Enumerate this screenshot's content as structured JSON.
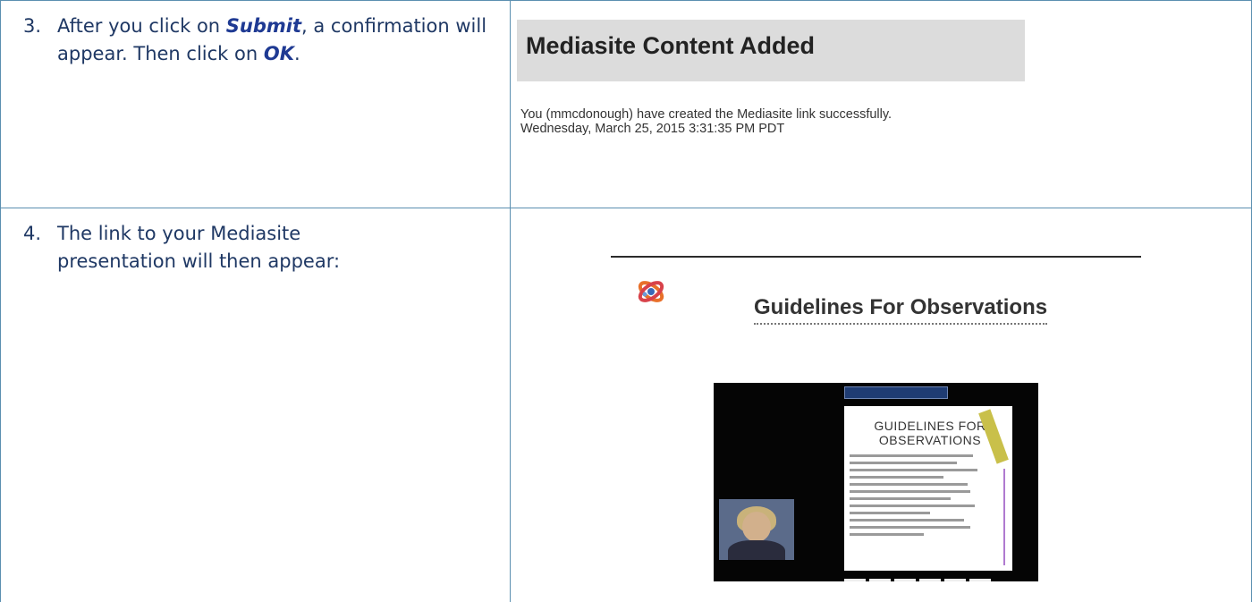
{
  "steps": [
    {
      "number": "3.",
      "text_before": "After you click on ",
      "emphasis1": "Submit",
      "text_mid": ", a confirmation will appear. Then click on ",
      "emphasis2": "OK",
      "text_after": "."
    },
    {
      "number": "4.",
      "text": "The link to your Mediasite presentation will then appear:"
    }
  ],
  "confirmation": {
    "title": "Mediasite Content Added",
    "message": "You (mmcdonough) have created the Mediasite link successfully.",
    "timestamp": "Wednesday, March 25, 2015 3:31:35 PM PDT"
  },
  "presentation": {
    "icon": "mediasite-logo-icon",
    "title": "Guidelines For Observations",
    "slide_title": "GUIDELINES FOR OBSERVATIONS"
  },
  "colors": {
    "table_border": "#5b8fb0",
    "step_text": "#1f3864",
    "emphasis": "#1f3a93",
    "confirmation_header_bg": "#dcdcdc"
  }
}
